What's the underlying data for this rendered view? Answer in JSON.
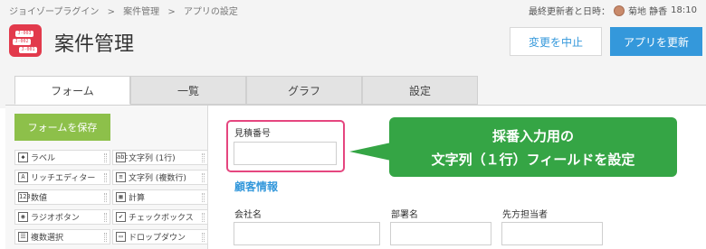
{
  "breadcrumb": {
    "items": [
      "ジョイゾープラグイン",
      ">",
      "案件管理",
      ">",
      "アプリの設定"
    ]
  },
  "meta": {
    "updated_prefix": "最終更新者と日時：",
    "user_name": "菊地 静香",
    "time": "18:10"
  },
  "app": {
    "title": "案件管理",
    "icon_labels": [
      "J-003",
      "J-002",
      "J-001"
    ]
  },
  "actions": {
    "cancel_label": "変更を中止",
    "update_label": "アプリを更新"
  },
  "tabs": [
    {
      "label": "フォーム",
      "active": true
    },
    {
      "label": "一覧",
      "active": false
    },
    {
      "label": "グラフ",
      "active": false
    },
    {
      "label": "設定",
      "active": false
    }
  ],
  "palette": {
    "save_label": "フォームを保存",
    "items": [
      {
        "label": "ラベル",
        "icon": "tag-icon",
        "glyph": "◆"
      },
      {
        "label": "文字列 (1行)",
        "icon": "text-single-icon",
        "glyph": "abc"
      },
      {
        "label": "リッチエディター",
        "icon": "rich-editor-icon",
        "glyph": "A"
      },
      {
        "label": "文字列 (複数行)",
        "icon": "text-multi-icon",
        "glyph": "≡"
      },
      {
        "label": "数値",
        "icon": "number-icon",
        "glyph": "123"
      },
      {
        "label": "計算",
        "icon": "calculator-icon",
        "glyph": "▦"
      },
      {
        "label": "ラジオボタン",
        "icon": "radio-icon",
        "glyph": "◉"
      },
      {
        "label": "チェックボックス",
        "icon": "checkbox-icon",
        "glyph": "✔"
      },
      {
        "label": "複数選択",
        "icon": "multi-select-icon",
        "glyph": "☰"
      },
      {
        "label": "ドロップダウン",
        "icon": "dropdown-icon",
        "glyph": "▭"
      }
    ]
  },
  "form": {
    "estimate_number_label": "見積番号",
    "section_title": "顧客情報",
    "company_label": "会社名",
    "department_label": "部署名",
    "contact_label": "先方担当者"
  },
  "callout": {
    "line1": "採番入力用の",
    "line2": "文字列（１行）フィールドを設定"
  },
  "colors": {
    "accent": "#3498db",
    "save_green": "#8dc04a",
    "callout_green": "#35a545",
    "highlight_pink": "#e5467f",
    "app_icon_red": "#e23a4c"
  }
}
